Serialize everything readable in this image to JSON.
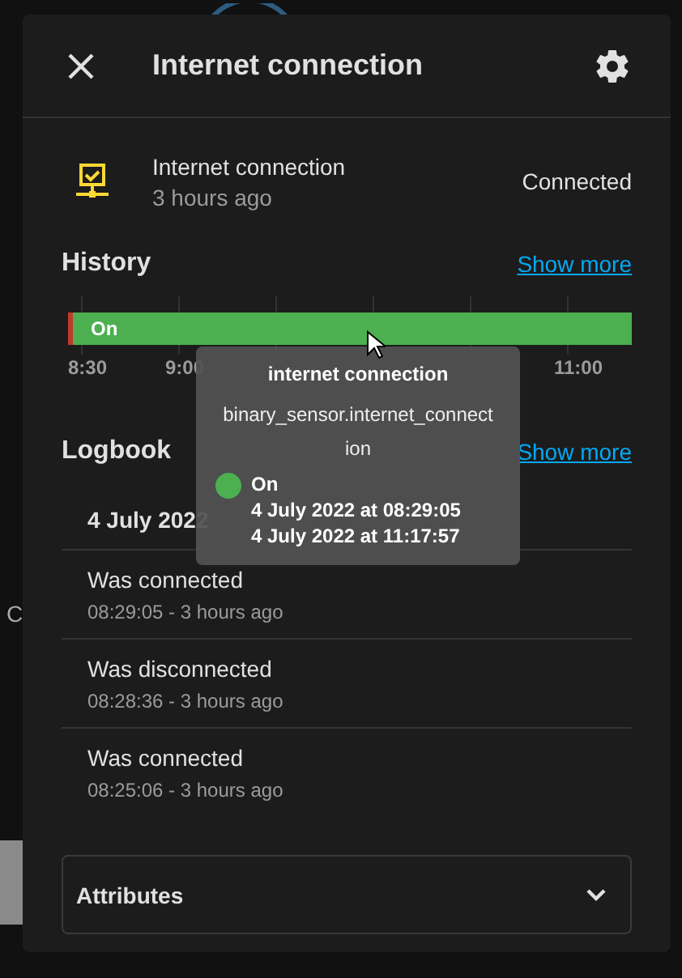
{
  "background": {
    "text": "C"
  },
  "dialog": {
    "title": "Internet connection"
  },
  "entity": {
    "name": "Internet connection",
    "updated": "3 hours ago",
    "state": "Connected"
  },
  "history": {
    "title": "History",
    "link": "Show more",
    "timeline": [
      {
        "kind": "off",
        "color": "#c0392b"
      },
      {
        "kind": "on",
        "color": "#4caf50",
        "label": "On"
      }
    ],
    "ticks": [
      "8:30",
      "9:00",
      "11:00"
    ]
  },
  "tooltip": {
    "title": "internet connection",
    "entity_id": "binary_sensor.internet_connect",
    "entity_id_rest": "ion",
    "state": "On",
    "color": "#4caf50",
    "start": "4 July 2022 at 08:29:05",
    "end": "4 July 2022 at 11:17:57"
  },
  "logbook": {
    "title": "Logbook",
    "link": "Show more",
    "date": "4 July 2022",
    "entries": [
      {
        "message": "Was connected",
        "time": "08:29:05 - 3 hours ago"
      },
      {
        "message": "Was disconnected",
        "time": "08:28:36 - 3 hours ago"
      },
      {
        "message": "Was connected",
        "time": "08:25:06 - 3 hours ago"
      }
    ]
  },
  "attributes": {
    "title": "Attributes",
    "expanded": false
  }
}
